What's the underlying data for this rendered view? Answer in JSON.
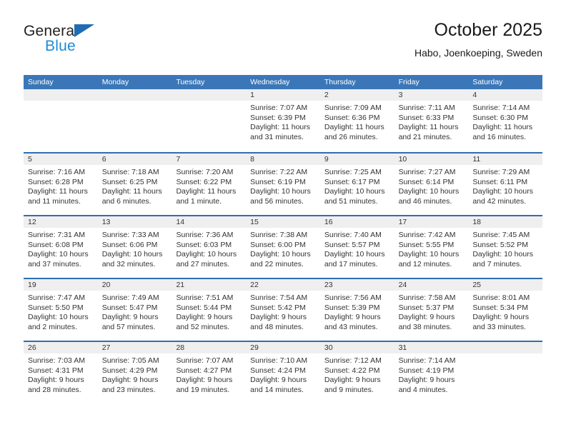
{
  "logo": {
    "word1": "General",
    "word2": "Blue",
    "triangle_color": "#1f6cb4",
    "blue_color": "#1f8ad6"
  },
  "header": {
    "title": "October 2025",
    "subtitle": "Habo, Joenkoeping, Sweden"
  },
  "theme": {
    "header_bar": "#3b77b8",
    "row_divider": "#2f6eae",
    "day_number_band": "#efefef"
  },
  "weekdays": [
    "Sunday",
    "Monday",
    "Tuesday",
    "Wednesday",
    "Thursday",
    "Friday",
    "Saturday"
  ],
  "weeks": [
    [
      {
        "day": "",
        "empty": true,
        "sunrise": "",
        "sunset": "",
        "daylight": ""
      },
      {
        "day": "",
        "empty": true,
        "sunrise": "",
        "sunset": "",
        "daylight": ""
      },
      {
        "day": "",
        "empty": true,
        "sunrise": "",
        "sunset": "",
        "daylight": ""
      },
      {
        "day": "1",
        "empty": false,
        "sunrise": "Sunrise: 7:07 AM",
        "sunset": "Sunset: 6:39 PM",
        "daylight": "Daylight: 11 hours and 31 minutes."
      },
      {
        "day": "2",
        "empty": false,
        "sunrise": "Sunrise: 7:09 AM",
        "sunset": "Sunset: 6:36 PM",
        "daylight": "Daylight: 11 hours and 26 minutes."
      },
      {
        "day": "3",
        "empty": false,
        "sunrise": "Sunrise: 7:11 AM",
        "sunset": "Sunset: 6:33 PM",
        "daylight": "Daylight: 11 hours and 21 minutes."
      },
      {
        "day": "4",
        "empty": false,
        "sunrise": "Sunrise: 7:14 AM",
        "sunset": "Sunset: 6:30 PM",
        "daylight": "Daylight: 11 hours and 16 minutes."
      }
    ],
    [
      {
        "day": "5",
        "empty": false,
        "sunrise": "Sunrise: 7:16 AM",
        "sunset": "Sunset: 6:28 PM",
        "daylight": "Daylight: 11 hours and 11 minutes."
      },
      {
        "day": "6",
        "empty": false,
        "sunrise": "Sunrise: 7:18 AM",
        "sunset": "Sunset: 6:25 PM",
        "daylight": "Daylight: 11 hours and 6 minutes."
      },
      {
        "day": "7",
        "empty": false,
        "sunrise": "Sunrise: 7:20 AM",
        "sunset": "Sunset: 6:22 PM",
        "daylight": "Daylight: 11 hours and 1 minute."
      },
      {
        "day": "8",
        "empty": false,
        "sunrise": "Sunrise: 7:22 AM",
        "sunset": "Sunset: 6:19 PM",
        "daylight": "Daylight: 10 hours and 56 minutes."
      },
      {
        "day": "9",
        "empty": false,
        "sunrise": "Sunrise: 7:25 AM",
        "sunset": "Sunset: 6:17 PM",
        "daylight": "Daylight: 10 hours and 51 minutes."
      },
      {
        "day": "10",
        "empty": false,
        "sunrise": "Sunrise: 7:27 AM",
        "sunset": "Sunset: 6:14 PM",
        "daylight": "Daylight: 10 hours and 46 minutes."
      },
      {
        "day": "11",
        "empty": false,
        "sunrise": "Sunrise: 7:29 AM",
        "sunset": "Sunset: 6:11 PM",
        "daylight": "Daylight: 10 hours and 42 minutes."
      }
    ],
    [
      {
        "day": "12",
        "empty": false,
        "sunrise": "Sunrise: 7:31 AM",
        "sunset": "Sunset: 6:08 PM",
        "daylight": "Daylight: 10 hours and 37 minutes."
      },
      {
        "day": "13",
        "empty": false,
        "sunrise": "Sunrise: 7:33 AM",
        "sunset": "Sunset: 6:06 PM",
        "daylight": "Daylight: 10 hours and 32 minutes."
      },
      {
        "day": "14",
        "empty": false,
        "sunrise": "Sunrise: 7:36 AM",
        "sunset": "Sunset: 6:03 PM",
        "daylight": "Daylight: 10 hours and 27 minutes."
      },
      {
        "day": "15",
        "empty": false,
        "sunrise": "Sunrise: 7:38 AM",
        "sunset": "Sunset: 6:00 PM",
        "daylight": "Daylight: 10 hours and 22 minutes."
      },
      {
        "day": "16",
        "empty": false,
        "sunrise": "Sunrise: 7:40 AM",
        "sunset": "Sunset: 5:57 PM",
        "daylight": "Daylight: 10 hours and 17 minutes."
      },
      {
        "day": "17",
        "empty": false,
        "sunrise": "Sunrise: 7:42 AM",
        "sunset": "Sunset: 5:55 PM",
        "daylight": "Daylight: 10 hours and 12 minutes."
      },
      {
        "day": "18",
        "empty": false,
        "sunrise": "Sunrise: 7:45 AM",
        "sunset": "Sunset: 5:52 PM",
        "daylight": "Daylight: 10 hours and 7 minutes."
      }
    ],
    [
      {
        "day": "19",
        "empty": false,
        "sunrise": "Sunrise: 7:47 AM",
        "sunset": "Sunset: 5:50 PM",
        "daylight": "Daylight: 10 hours and 2 minutes."
      },
      {
        "day": "20",
        "empty": false,
        "sunrise": "Sunrise: 7:49 AM",
        "sunset": "Sunset: 5:47 PM",
        "daylight": "Daylight: 9 hours and 57 minutes."
      },
      {
        "day": "21",
        "empty": false,
        "sunrise": "Sunrise: 7:51 AM",
        "sunset": "Sunset: 5:44 PM",
        "daylight": "Daylight: 9 hours and 52 minutes."
      },
      {
        "day": "22",
        "empty": false,
        "sunrise": "Sunrise: 7:54 AM",
        "sunset": "Sunset: 5:42 PM",
        "daylight": "Daylight: 9 hours and 48 minutes."
      },
      {
        "day": "23",
        "empty": false,
        "sunrise": "Sunrise: 7:56 AM",
        "sunset": "Sunset: 5:39 PM",
        "daylight": "Daylight: 9 hours and 43 minutes."
      },
      {
        "day": "24",
        "empty": false,
        "sunrise": "Sunrise: 7:58 AM",
        "sunset": "Sunset: 5:37 PM",
        "daylight": "Daylight: 9 hours and 38 minutes."
      },
      {
        "day": "25",
        "empty": false,
        "sunrise": "Sunrise: 8:01 AM",
        "sunset": "Sunset: 5:34 PM",
        "daylight": "Daylight: 9 hours and 33 minutes."
      }
    ],
    [
      {
        "day": "26",
        "empty": false,
        "sunrise": "Sunrise: 7:03 AM",
        "sunset": "Sunset: 4:31 PM",
        "daylight": "Daylight: 9 hours and 28 minutes."
      },
      {
        "day": "27",
        "empty": false,
        "sunrise": "Sunrise: 7:05 AM",
        "sunset": "Sunset: 4:29 PM",
        "daylight": "Daylight: 9 hours and 23 minutes."
      },
      {
        "day": "28",
        "empty": false,
        "sunrise": "Sunrise: 7:07 AM",
        "sunset": "Sunset: 4:27 PM",
        "daylight": "Daylight: 9 hours and 19 minutes."
      },
      {
        "day": "29",
        "empty": false,
        "sunrise": "Sunrise: 7:10 AM",
        "sunset": "Sunset: 4:24 PM",
        "daylight": "Daylight: 9 hours and 14 minutes."
      },
      {
        "day": "30",
        "empty": false,
        "sunrise": "Sunrise: 7:12 AM",
        "sunset": "Sunset: 4:22 PM",
        "daylight": "Daylight: 9 hours and 9 minutes."
      },
      {
        "day": "31",
        "empty": false,
        "sunrise": "Sunrise: 7:14 AM",
        "sunset": "Sunset: 4:19 PM",
        "daylight": "Daylight: 9 hours and 4 minutes."
      },
      {
        "day": "",
        "empty": true,
        "sunrise": "",
        "sunset": "",
        "daylight": ""
      }
    ]
  ]
}
